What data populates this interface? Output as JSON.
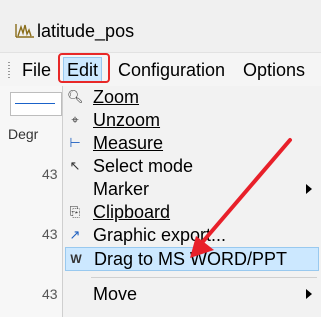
{
  "window": {
    "title": "latitude_pos"
  },
  "menubar": {
    "items": [
      "File",
      "Edit",
      "Configuration",
      "Options"
    ],
    "active": "Edit"
  },
  "left_panel": {
    "label": "Degr",
    "ticks": [
      "43",
      "43",
      "43"
    ]
  },
  "edit_menu": {
    "items": [
      {
        "icon": "zoom-in-icon",
        "label": "Zoom"
      },
      {
        "icon": "unzoom-icon",
        "label": "Unzoom"
      },
      {
        "icon": "measure-icon",
        "label": "Measure"
      },
      {
        "icon": "cursor-icon",
        "label": "Select mode"
      },
      {
        "icon": "",
        "label": "Marker"
      },
      {
        "icon": "clipboard-icon",
        "label": "Clipboard"
      },
      {
        "icon": "export-icon",
        "label": "Graphic export..."
      },
      {
        "icon": "word-icon",
        "label": "Drag to MS WORD/PPT"
      },
      {
        "icon": "",
        "label": "Move"
      }
    ]
  },
  "colors": {
    "highlight_border": "#e82828",
    "selection_bg": "#cce8ff",
    "annotation_arrow": "#e8202a"
  }
}
